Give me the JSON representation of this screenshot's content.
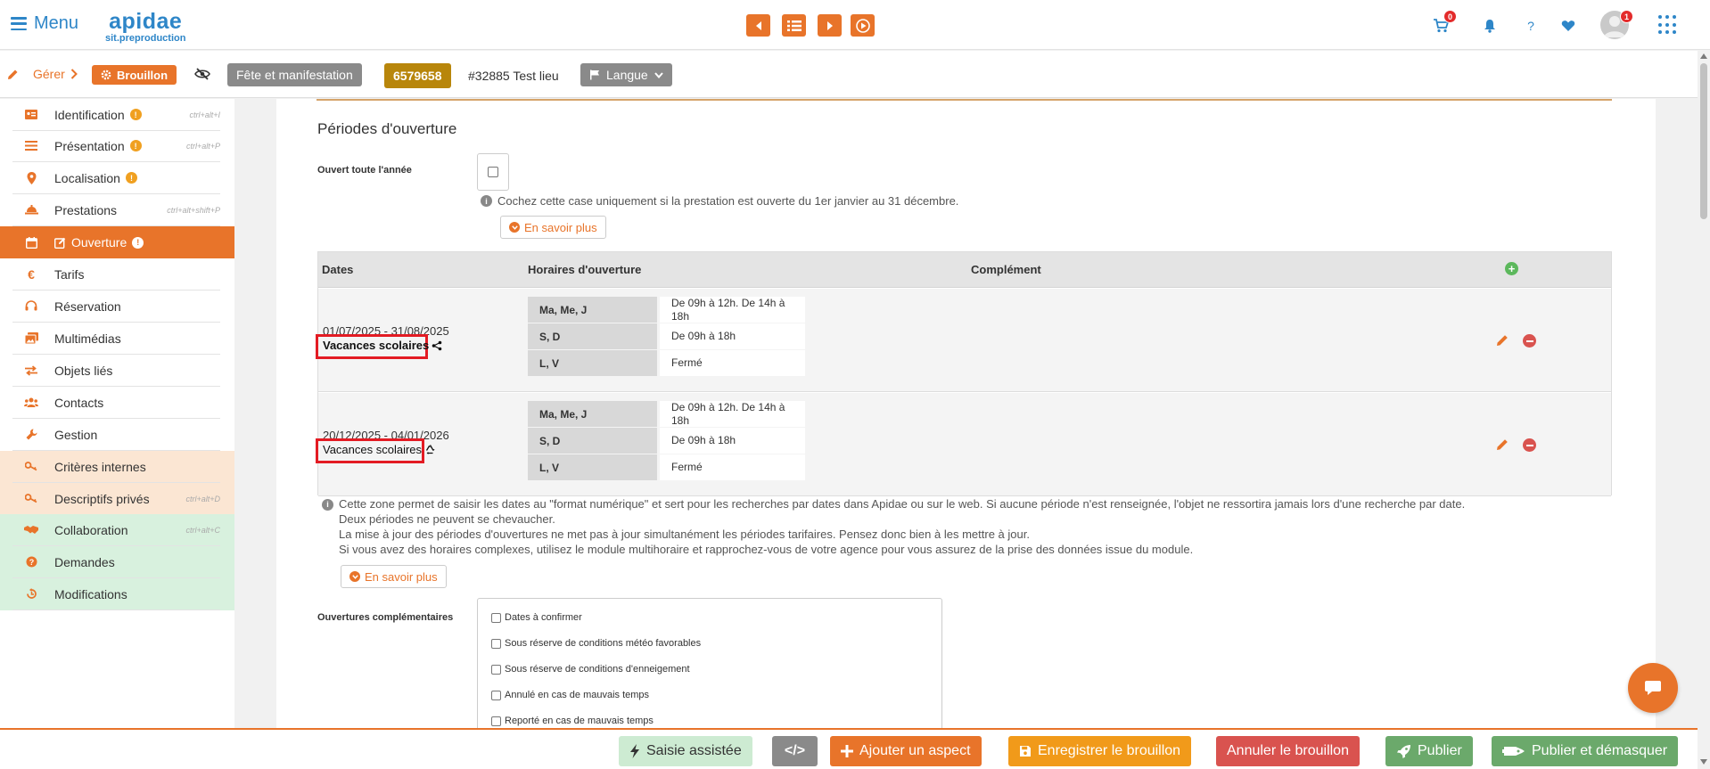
{
  "header": {
    "menu_label": "Menu",
    "logo_main": "apidae",
    "logo_sub": "sit.preproduction",
    "cart_count": "0",
    "help_label": "?",
    "avatar_badge": "1",
    "accent": "#e8742a",
    "brand": "#2e86c8"
  },
  "toolbar": {
    "gerer_label": "Gérer",
    "status_label": "Brouillon",
    "type_label": "Fête et manifestation",
    "object_id": "6579658",
    "lieu_label": "#32885 Test lieu",
    "langue_label": "Langue"
  },
  "sidebar": {
    "items": [
      {
        "label": "Identification",
        "warn": "!",
        "shortcut": "ctrl+alt+I",
        "icon": "id-card-icon"
      },
      {
        "label": "Présentation",
        "warn": "!",
        "shortcut": "ctrl+alt+P",
        "icon": "list-icon"
      },
      {
        "label": "Localisation",
        "warn": "!",
        "shortcut": "",
        "icon": "map-pin-icon"
      },
      {
        "label": "Prestations",
        "warn": "",
        "shortcut": "ctrl+alt+shift+P",
        "icon": "service-bell-icon"
      },
      {
        "label": "Ouverture",
        "warn": "!",
        "shortcut": "",
        "icon": "calendar-icon"
      },
      {
        "label": "Tarifs",
        "warn": "",
        "shortcut": "",
        "icon": "euro-icon"
      },
      {
        "label": "Réservation",
        "warn": "",
        "shortcut": "",
        "icon": "headset-icon"
      },
      {
        "label": "Multimédias",
        "warn": "",
        "shortcut": "",
        "icon": "images-icon"
      },
      {
        "label": "Objets liés",
        "warn": "",
        "shortcut": "",
        "icon": "exchange-icon"
      },
      {
        "label": "Contacts",
        "warn": "",
        "shortcut": "",
        "icon": "users-icon"
      },
      {
        "label": "Gestion",
        "warn": "",
        "shortcut": "",
        "icon": "wrench-icon"
      },
      {
        "label": "Critères internes",
        "warn": "",
        "shortcut": "",
        "icon": "key-icon"
      },
      {
        "label": "Descriptifs privés",
        "warn": "",
        "shortcut": "ctrl+alt+D",
        "icon": "key-icon"
      },
      {
        "label": "Collaboration",
        "warn": "",
        "shortcut": "ctrl+alt+C",
        "icon": "handshake-icon"
      },
      {
        "label": "Demandes",
        "warn": "",
        "shortcut": "",
        "icon": "question-circle-icon"
      },
      {
        "label": "Modifications",
        "warn": "",
        "shortcut": "",
        "icon": "history-icon"
      }
    ]
  },
  "main": {
    "section_title": "Périodes d'ouverture",
    "open_all_year_label": "Ouvert toute l'année",
    "open_all_year_help": "Cochez cette case uniquement si la prestation est ouverte du 1er janvier au 31 décembre.",
    "learn_more_label": "En savoir plus",
    "table_headers": {
      "dates": "Dates",
      "hours": "Horaires d'ouverture",
      "complement": "Complément"
    },
    "periods": [
      {
        "dates": "01/07/2025 - 31/08/2025",
        "label": "Vacances scolaires",
        "hours": [
          {
            "days": "Ma, Me, J",
            "value": "De 09h à 12h. De 14h à 18h"
          },
          {
            "days": "S, D",
            "value": "De 09h à 18h"
          },
          {
            "days": "L, V",
            "value": "Fermé"
          }
        ]
      },
      {
        "dates": "20/12/2025 - 04/01/2026",
        "label": "Vacances scolaires",
        "hours": [
          {
            "days": "Ma, Me, J",
            "value": "De 09h à 12h. De 14h à 18h"
          },
          {
            "days": "S, D",
            "value": "De 09h à 18h"
          },
          {
            "days": "L, V",
            "value": "Fermé"
          }
        ]
      }
    ],
    "notes": [
      "Cette zone permet de saisir les dates au \"format numérique\" et sert pour les recherches par dates dans Apidae ou sur le web. Si aucune période n'est renseignée, l'objet ne ressortira jamais lors d'une recherche par date.",
      "Deux périodes ne peuvent se chevaucher.",
      "La mise à jour des périodes d'ouvertures ne met pas à jour simultanément les périodes tarifaires. Pensez donc bien à les mettre à jour.",
      "Si vous avez des horaires complexes, utilisez le module multihoraire et rapprochez-vous de votre agence pour vous assurez de la prise des données issue du module."
    ],
    "complementary_label": "Ouvertures complémentaires",
    "complementary_options": [
      "Dates à confirmer",
      "Sous réserve de conditions météo favorables",
      "Sous réserve de conditions d'enneigement",
      "Annulé en cas de mauvais temps",
      "Reporté en cas de mauvais temps"
    ]
  },
  "bottom": {
    "assist_label": "Saisie assistée",
    "code_label": "</>",
    "add_aspect_label": "Ajouter un aspect",
    "save_draft_label": "Enregistrer le brouillon",
    "cancel_draft_label": "Annuler le brouillon",
    "publish_label": "Publier",
    "publish_unmask_label": "Publier et démasquer"
  }
}
